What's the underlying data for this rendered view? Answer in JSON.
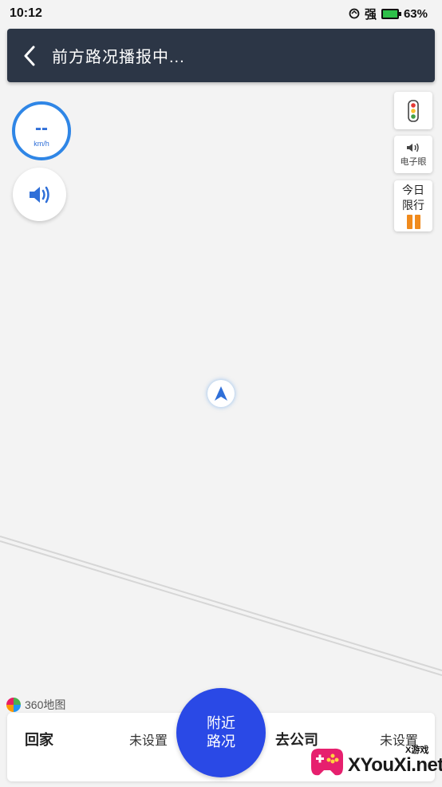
{
  "status_bar": {
    "time": "10:12",
    "signal_text": "强",
    "battery": "63%"
  },
  "header": {
    "title": "前方路况播报中..."
  },
  "speed": {
    "value": "--",
    "unit": "km/h"
  },
  "side_buttons": {
    "electronic_eye": "电子眼",
    "restriction_line1": "今日",
    "restriction_line2": "限行"
  },
  "brand": "360地图",
  "bottom": {
    "home_label": "回家",
    "home_value": "未设置",
    "nearby_line1": "附近",
    "nearby_line2": "路况",
    "work_label": "去公司",
    "work_value": "未设置"
  },
  "watermark": {
    "text": "XYouXi.net",
    "tag": "X游戏"
  },
  "colors": {
    "header_bg": "#2c3646",
    "accent": "#2a49e6",
    "speed_ring": "#2f86e6",
    "restriction": "#f08a1c"
  }
}
